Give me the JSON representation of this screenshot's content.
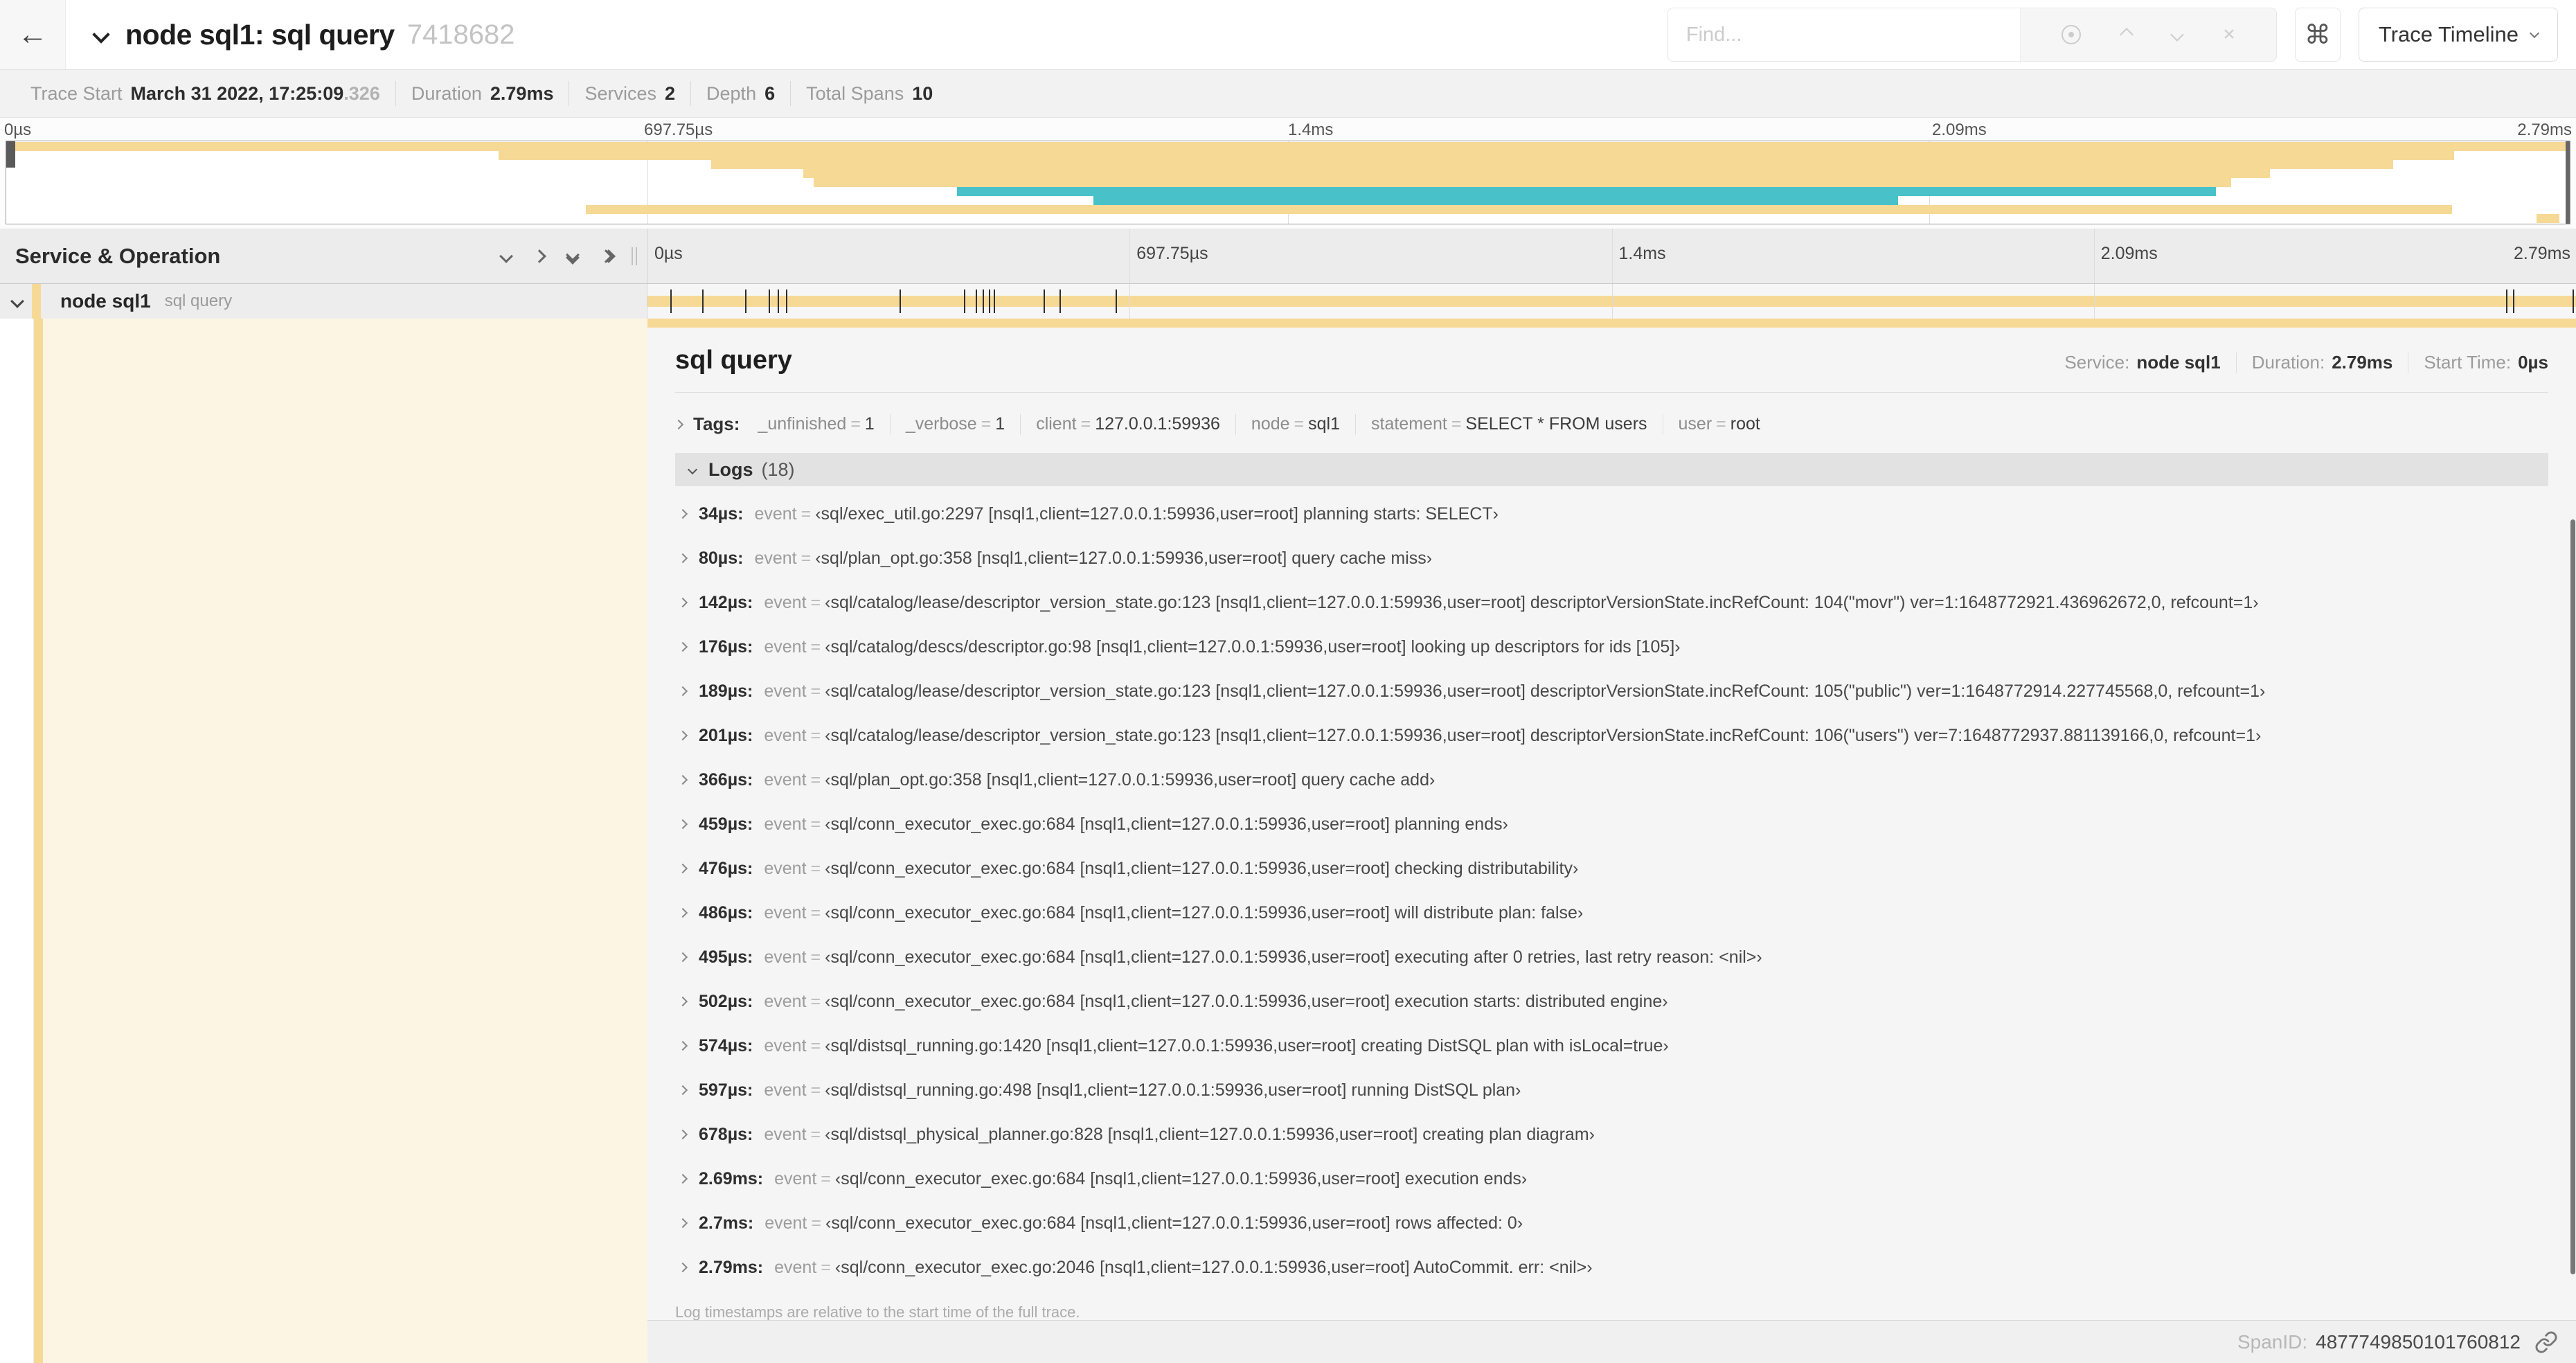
{
  "colors": {
    "span_tan": "#f7d996",
    "span_teal": "#48c2c8",
    "row_cream": "#fcf5e3"
  },
  "icons": {
    "back": "←",
    "clear": "×",
    "command": "⌘"
  },
  "header": {
    "title": "node sql1: sql query",
    "trace_id": "7418682",
    "find_placeholder": "Find...",
    "view_button_label": "Trace Timeline"
  },
  "stats": [
    {
      "label": "Trace Start",
      "value": "March 31 2022, 17:25:09",
      "suffix": ".326"
    },
    {
      "label": "Duration",
      "value": "2.79ms"
    },
    {
      "label": "Services",
      "value": "2"
    },
    {
      "label": "Depth",
      "value": "6"
    },
    {
      "label": "Total Spans",
      "value": "10"
    }
  ],
  "timeline": {
    "column_header": "Service & Operation",
    "ticks": [
      {
        "label": "0µs",
        "pct": 0
      },
      {
        "label": "697.75µs",
        "pct": 25
      },
      {
        "label": "1.4ms",
        "pct": 50
      },
      {
        "label": "2.09ms",
        "pct": 75
      },
      {
        "label": "2.79ms",
        "pct": 100
      }
    ]
  },
  "minimap": {
    "rows": [
      {
        "start": 0,
        "end": 100,
        "color": "span_tan"
      },
      {
        "start": 19.2,
        "end": 95.5,
        "color": "span_tan"
      },
      {
        "start": 27.5,
        "end": 93.1,
        "color": "span_tan"
      },
      {
        "start": 31.1,
        "end": 88.3,
        "color": "span_tan"
      },
      {
        "start": 31.5,
        "end": 86.8,
        "color": "span_tan"
      },
      {
        "start": 37.1,
        "end": 86.2,
        "color": "span_teal"
      },
      {
        "start": 42.4,
        "end": 73.8,
        "color": "span_teal"
      },
      {
        "start": 22.6,
        "end": 95.4,
        "color": "span_tan"
      },
      {
        "start": 98.7,
        "end": 99.6,
        "color": "span_tan"
      }
    ]
  },
  "trace": {
    "duration_us": 2790,
    "service": "node sql1",
    "operation": "sql query"
  },
  "span_detail": {
    "title": "sql query",
    "service_label": "Service:",
    "service": "node sql1",
    "duration_label": "Duration:",
    "duration": "2.79ms",
    "start_label": "Start Time:",
    "start": "0µs",
    "tags_label": "Tags:",
    "eq": "=",
    "tags": [
      {
        "key": "_unfinished",
        "value": "1"
      },
      {
        "key": "_verbose",
        "value": "1"
      },
      {
        "key": "client",
        "value": "127.0.0.1:59936"
      },
      {
        "key": "node",
        "value": "sql1"
      },
      {
        "key": "statement",
        "value": "SELECT * FROM users"
      },
      {
        "key": "user",
        "value": "root"
      }
    ],
    "logs_label": "Logs",
    "logs_count": "(18)",
    "log_key": "event",
    "logs": [
      {
        "time": "34µs:",
        "t_us": 34,
        "value": "‹sql/exec_util.go:2297 [nsql1,client=127.0.0.1:59936,user=root] planning starts: SELECT›"
      },
      {
        "time": "80µs:",
        "t_us": 80,
        "value": "‹sql/plan_opt.go:358 [nsql1,client=127.0.0.1:59936,user=root] query cache miss›"
      },
      {
        "time": "142µs:",
        "t_us": 142,
        "value": "‹sql/catalog/lease/descriptor_version_state.go:123 [nsql1,client=127.0.0.1:59936,user=root] descriptorVersionState.incRefCount: 104(\"movr\") ver=1:1648772921.436962672,0, refcount=1›"
      },
      {
        "time": "176µs:",
        "t_us": 176,
        "value": "‹sql/catalog/descs/descriptor.go:98 [nsql1,client=127.0.0.1:59936,user=root] looking up descriptors for ids [105]›"
      },
      {
        "time": "189µs:",
        "t_us": 189,
        "value": "‹sql/catalog/lease/descriptor_version_state.go:123 [nsql1,client=127.0.0.1:59936,user=root] descriptorVersionState.incRefCount: 105(\"public\") ver=1:1648772914.227745568,0, refcount=1›"
      },
      {
        "time": "201µs:",
        "t_us": 201,
        "value": "‹sql/catalog/lease/descriptor_version_state.go:123 [nsql1,client=127.0.0.1:59936,user=root] descriptorVersionState.incRefCount: 106(\"users\") ver=7:1648772937.881139166,0, refcount=1›"
      },
      {
        "time": "366µs:",
        "t_us": 366,
        "value": "‹sql/plan_opt.go:358 [nsql1,client=127.0.0.1:59936,user=root] query cache add›"
      },
      {
        "time": "459µs:",
        "t_us": 459,
        "value": "‹sql/conn_executor_exec.go:684 [nsql1,client=127.0.0.1:59936,user=root] planning ends›"
      },
      {
        "time": "476µs:",
        "t_us": 476,
        "value": "‹sql/conn_executor_exec.go:684 [nsql1,client=127.0.0.1:59936,user=root] checking distributability›"
      },
      {
        "time": "486µs:",
        "t_us": 486,
        "value": "‹sql/conn_executor_exec.go:684 [nsql1,client=127.0.0.1:59936,user=root] will distribute plan: false›"
      },
      {
        "time": "495µs:",
        "t_us": 495,
        "value": "‹sql/conn_executor_exec.go:684 [nsql1,client=127.0.0.1:59936,user=root] executing after 0 retries, last retry reason: <nil>›"
      },
      {
        "time": "502µs:",
        "t_us": 502,
        "value": "‹sql/conn_executor_exec.go:684 [nsql1,client=127.0.0.1:59936,user=root] execution starts: distributed engine›"
      },
      {
        "time": "574µs:",
        "t_us": 574,
        "value": "‹sql/distsql_running.go:1420 [nsql1,client=127.0.0.1:59936,user=root] creating DistSQL plan with isLocal=true›"
      },
      {
        "time": "597µs:",
        "t_us": 597,
        "value": "‹sql/distsql_running.go:498 [nsql1,client=127.0.0.1:59936,user=root] running DistSQL plan›"
      },
      {
        "time": "678µs:",
        "t_us": 678,
        "value": "‹sql/distsql_physical_planner.go:828 [nsql1,client=127.0.0.1:59936,user=root] creating plan diagram›"
      },
      {
        "time": "2.69ms:",
        "t_us": 2690,
        "value": "‹sql/conn_executor_exec.go:684 [nsql1,client=127.0.0.1:59936,user=root] execution ends›"
      },
      {
        "time": "2.7ms:",
        "t_us": 2700,
        "value": "‹sql/conn_executor_exec.go:684 [nsql1,client=127.0.0.1:59936,user=root] rows affected: 0›"
      },
      {
        "time": "2.79ms:",
        "t_us": 2790,
        "value": "‹sql/conn_executor_exec.go:2046 [nsql1,client=127.0.0.1:59936,user=root] AutoCommit. err: <nil>›"
      }
    ],
    "footnote": "Log timestamps are relative to the start time of the full trace."
  },
  "footer": {
    "spanid_label": "SpanID:",
    "spanid": "4877749850101760812"
  }
}
